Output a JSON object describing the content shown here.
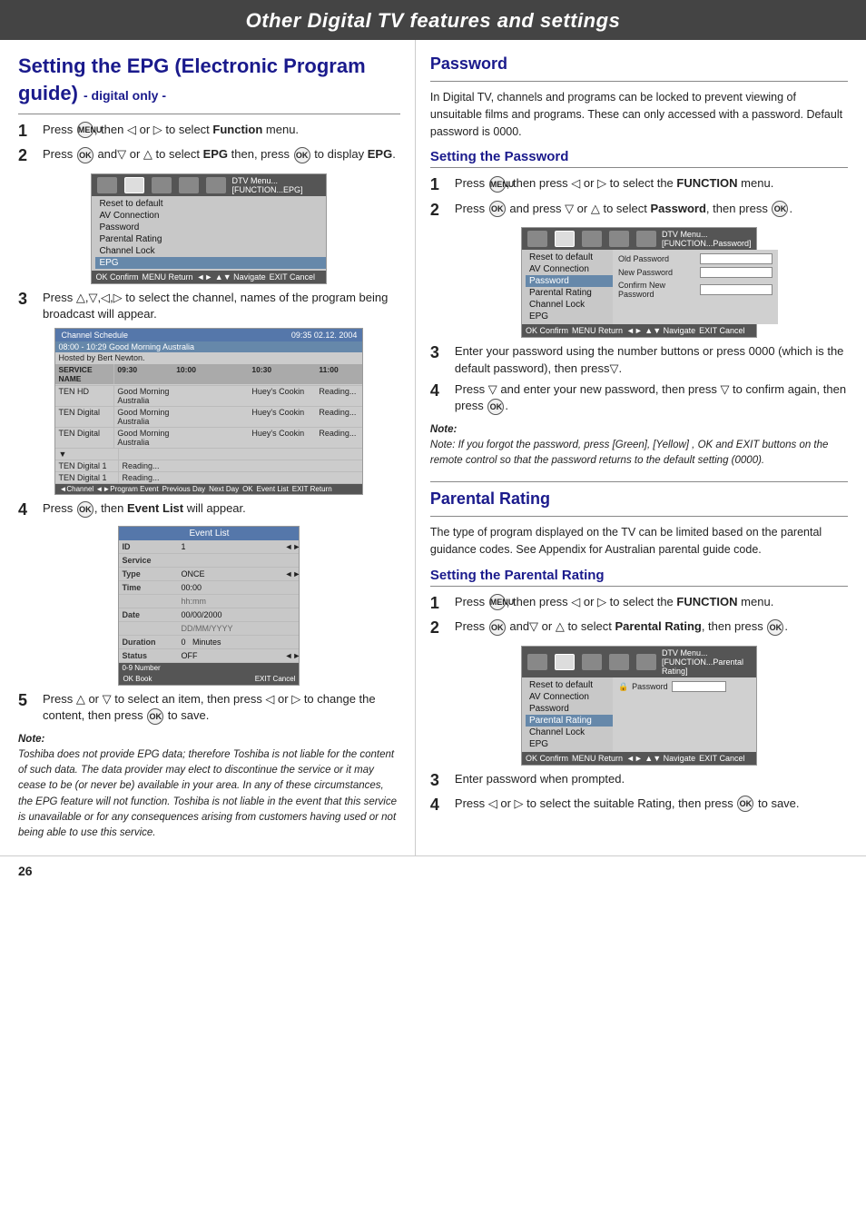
{
  "page": {
    "title": "Other Digital TV features and settings",
    "number": "26"
  },
  "epg_section": {
    "title_line1": "Setting the EPG (Electronic Program",
    "title_line2": "guide)",
    "title_suffix": " - digital only -",
    "steps": [
      {
        "num": "1",
        "text": "Press ",
        "btn1": "MENU",
        "mid": ", then ◁ or ▷ to select ",
        "bold": "Function",
        "end": " menu."
      },
      {
        "num": "2",
        "text": "Press ",
        "btn1": "OK",
        "mid": " and▽ or △ to select ",
        "bold": "EPG",
        "mid2": " then, press ",
        "btn2": "OK",
        "end": " to display ",
        "bold2": "EPG",
        "end2": "."
      }
    ],
    "step3_text": "Press △,▽,◁,▷ to select the channel, names of the program being broadcast will appear.",
    "step4_text": "Press ",
    "step4_bold": "Event List",
    "step4_end": " will appear.",
    "step5_text": "Press △ or ▽ to select an item, then press ◁ or ▷ to change the content, then press ",
    "step5_btn": "OK",
    "step5_end": " to save.",
    "note_label": "Note:",
    "note_text": "Toshiba does not provide EPG data; therefore Toshiba is not liable for the content of such data. The data provider may elect to discontinue the service or it may cease to be (or never be) available in your area. In any of these circumstances, the EPG feature will not function. Toshiba is not liable in the event that this service is unavailable or for any consequences arising from customers having used or not being able to use this service.",
    "menu1": {
      "title": "DTV Menu...[FUNCTION...EPG]",
      "icons": [
        "folder",
        "camera",
        "list",
        "globe",
        "arrow"
      ],
      "items": [
        "Reset to default",
        "AV Connection",
        "Password",
        "Parental Rating",
        "Channel Lock",
        "EPG"
      ],
      "selected": "EPG",
      "footer": "OK Confirm  MENU Return  ◄► ▲▼ Navigate  EXIT Cancel"
    },
    "schedule": {
      "title": "Channel Schedule",
      "time": "09:35  02.12. 2004",
      "highlight_row": "08:00 - 10:29  Good Morning Australia",
      "subtext": "Hosted by Bert Newton.",
      "header": [
        "SERVICE NAME",
        "09:30",
        "10:00",
        "10:30",
        "11:00"
      ],
      "rows": [
        [
          "TEN HD",
          "Good Morning Australia",
          "",
          "Huey's Cookin",
          "Reading..."
        ],
        [
          "TEN Digital",
          "Good Morning Australia",
          "",
          "Huey's Cookin",
          "Reading..."
        ],
        [
          "TEN Digital",
          "Good Morning Australia",
          "",
          "Huey's Cookin",
          "Reading..."
        ],
        [
          "TEN Digital 1",
          "Reading...",
          "",
          "",
          ""
        ],
        [
          "TEN Digital 1",
          "Reading...",
          "",
          "",
          ""
        ]
      ],
      "footer": "◄Channel  ◄►Program Event    Previous Day    Next Day  OK  Event List  EXIT Return"
    },
    "event_list": {
      "title": "Event List",
      "rows": [
        {
          "label": "ID",
          "value": "1",
          "arrow": "◄►"
        },
        {
          "label": "Service",
          "value": "",
          "arrow": ""
        },
        {
          "label": "Type",
          "value": "ONCE",
          "arrow": "◄►"
        },
        {
          "label": "Time",
          "value": "00:00",
          "arrow": ""
        },
        {
          "label": "",
          "value": "hh:mm",
          "arrow": ""
        },
        {
          "label": "Date",
          "value": "00/00/2000",
          "arrow": ""
        },
        {
          "label": "",
          "value": "DD/MM/YYYY",
          "arrow": ""
        },
        {
          "label": "Duration",
          "value": "0   Minutes",
          "arrow": ""
        },
        {
          "label": "Status",
          "value": "OFF",
          "arrow": "◄►"
        }
      ],
      "footer_left": "0-9 Number",
      "footer_right": "OK Book    EXIT Cancel"
    }
  },
  "password_section": {
    "title": "Password",
    "intro": "In Digital TV, channels and programs can be locked to prevent viewing of unsuitable films and programs. These can only accessed with a password. Default password is 0000.",
    "setting_title": "Setting the Password",
    "steps": [
      {
        "num": "1",
        "text": "Press ",
        "btn1": "MENU",
        "mid": ", then press ◁ or ▷ to select the ",
        "bold": "FUNCTION",
        "end": " menu."
      },
      {
        "num": "2",
        "text": "Press ",
        "btn1": "OK",
        "mid": " and press ▽ or △ to select ",
        "bold": "Password",
        "mid2": ", then press ",
        "btn2": "OK",
        "end": "."
      }
    ],
    "step3_text": "Enter your password using the number buttons or press 0000 (which is the default password), then press▽.",
    "step4_text": "Press ▽ and enter your new password, then press ▽ to confirm again, then press ",
    "step4_btn": "OK",
    "step4_end": ".",
    "note_label": "Note:",
    "note_text": "Note: If you forgot the password, press [Green], [Yellow] , OK and EXIT buttons on the remote control  so that the password returns to the default setting (0000).",
    "menu": {
      "title": "DTV Menu...[FUNCTION...Password]",
      "icons": [
        "folder",
        "camera",
        "list",
        "globe",
        "arrow"
      ],
      "items": [
        "Reset to default",
        "AV Connection",
        "Password",
        "Parental Rating",
        "Channel Lock",
        "EPG"
      ],
      "selected": "Password",
      "fields": [
        {
          "label": "Old Password",
          "input": ""
        },
        {
          "label": "New Password",
          "input": ""
        },
        {
          "label": "Confirm New Password",
          "input": ""
        }
      ],
      "footer": "OK Confirm  MENU Return  ◄► ▲▼ Navigate  EXIT Cancel"
    }
  },
  "parental_section": {
    "title": "Parental Rating",
    "intro": "The type of program displayed on the TV can be limited based on the parental guidance codes. See Appendix for Australian parental guide code.",
    "setting_title": "Setting the Parental Rating",
    "steps": [
      {
        "num": "1",
        "text": "Press ",
        "btn1": "MENU",
        "mid": ", then press ◁ or ▷ to select the ",
        "bold": "FUNCTION",
        "end": " menu."
      },
      {
        "num": "2",
        "text": "Press ",
        "btn1": "OK",
        "mid": " and▽ or △ to select ",
        "bold": "Parental Rating",
        "mid2": ", then press ",
        "btn2": "OK",
        "end": "."
      }
    ],
    "step3_text": "Enter password when prompted.",
    "step4_text": "Press ◁ or ▷ to select the suitable Rating, then press ",
    "step4_btn": "OK",
    "step4_end": " to save.",
    "menu": {
      "title": "DTV Menu...[FUNCTION...Parental Rating]",
      "icons": [
        "folder",
        "camera",
        "list",
        "globe",
        "arrow"
      ],
      "items": [
        "Reset to default",
        "AV Connection",
        "Password",
        "Parental Rating",
        "Channel Lock",
        "EPG"
      ],
      "selected": "Parental Rating",
      "fields": [
        {
          "label": "Parental Rating",
          "input": "Password"
        }
      ],
      "footer": "OK Confirm  MENU Return  ◄► ▲▼ Navigate  EXIT Cancel"
    }
  }
}
